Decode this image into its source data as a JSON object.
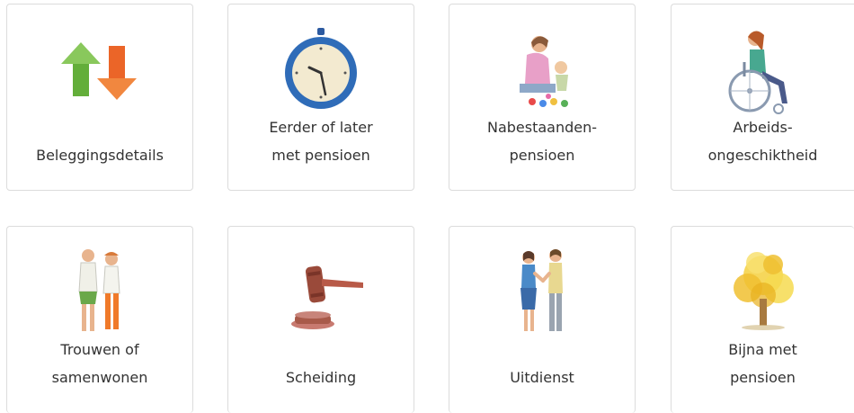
{
  "tiles": [
    {
      "icon": "arrows-up-down-icon",
      "lines": [
        "Beleggingsdetails"
      ]
    },
    {
      "icon": "clock-icon",
      "lines": [
        "Eerder of later",
        "met pensioen"
      ]
    },
    {
      "icon": "mother-child-playing-icon",
      "lines": [
        "Nabestaanden-",
        "pensioen"
      ]
    },
    {
      "icon": "wheelchair-person-icon",
      "lines": [
        "Arbeids-",
        "ongeschiktheid"
      ]
    },
    {
      "icon": "couple-icon",
      "lines": [
        "Trouwen of",
        "samenwonen"
      ]
    },
    {
      "icon": "judge-gavel-icon",
      "lines": [
        "Scheiding"
      ]
    },
    {
      "icon": "handshake-icon",
      "lines": [
        "Uitdienst"
      ]
    },
    {
      "icon": "autumn-tree-icon",
      "lines": [
        "Bijna met",
        "pensioen"
      ]
    }
  ]
}
